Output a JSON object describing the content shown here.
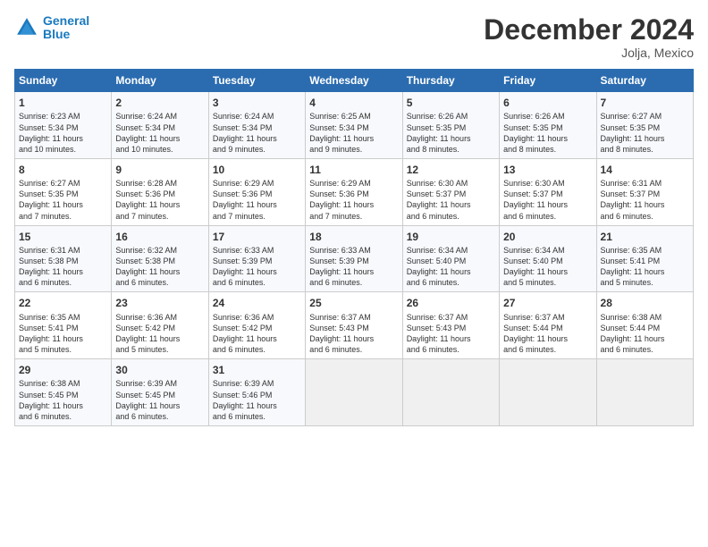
{
  "logo": {
    "line1": "General",
    "line2": "Blue"
  },
  "title": "December 2024",
  "location": "Jolja, Mexico",
  "days_header": [
    "Sunday",
    "Monday",
    "Tuesday",
    "Wednesday",
    "Thursday",
    "Friday",
    "Saturday"
  ],
  "weeks": [
    [
      {
        "day": "1",
        "info": "Sunrise: 6:23 AM\nSunset: 5:34 PM\nDaylight: 11 hours\nand 10 minutes."
      },
      {
        "day": "2",
        "info": "Sunrise: 6:24 AM\nSunset: 5:34 PM\nDaylight: 11 hours\nand 10 minutes."
      },
      {
        "day": "3",
        "info": "Sunrise: 6:24 AM\nSunset: 5:34 PM\nDaylight: 11 hours\nand 9 minutes."
      },
      {
        "day": "4",
        "info": "Sunrise: 6:25 AM\nSunset: 5:34 PM\nDaylight: 11 hours\nand 9 minutes."
      },
      {
        "day": "5",
        "info": "Sunrise: 6:26 AM\nSunset: 5:35 PM\nDaylight: 11 hours\nand 8 minutes."
      },
      {
        "day": "6",
        "info": "Sunrise: 6:26 AM\nSunset: 5:35 PM\nDaylight: 11 hours\nand 8 minutes."
      },
      {
        "day": "7",
        "info": "Sunrise: 6:27 AM\nSunset: 5:35 PM\nDaylight: 11 hours\nand 8 minutes."
      }
    ],
    [
      {
        "day": "8",
        "info": "Sunrise: 6:27 AM\nSunset: 5:35 PM\nDaylight: 11 hours\nand 7 minutes."
      },
      {
        "day": "9",
        "info": "Sunrise: 6:28 AM\nSunset: 5:36 PM\nDaylight: 11 hours\nand 7 minutes."
      },
      {
        "day": "10",
        "info": "Sunrise: 6:29 AM\nSunset: 5:36 PM\nDaylight: 11 hours\nand 7 minutes."
      },
      {
        "day": "11",
        "info": "Sunrise: 6:29 AM\nSunset: 5:36 PM\nDaylight: 11 hours\nand 7 minutes."
      },
      {
        "day": "12",
        "info": "Sunrise: 6:30 AM\nSunset: 5:37 PM\nDaylight: 11 hours\nand 6 minutes."
      },
      {
        "day": "13",
        "info": "Sunrise: 6:30 AM\nSunset: 5:37 PM\nDaylight: 11 hours\nand 6 minutes."
      },
      {
        "day": "14",
        "info": "Sunrise: 6:31 AM\nSunset: 5:37 PM\nDaylight: 11 hours\nand 6 minutes."
      }
    ],
    [
      {
        "day": "15",
        "info": "Sunrise: 6:31 AM\nSunset: 5:38 PM\nDaylight: 11 hours\nand 6 minutes."
      },
      {
        "day": "16",
        "info": "Sunrise: 6:32 AM\nSunset: 5:38 PM\nDaylight: 11 hours\nand 6 minutes."
      },
      {
        "day": "17",
        "info": "Sunrise: 6:33 AM\nSunset: 5:39 PM\nDaylight: 11 hours\nand 6 minutes."
      },
      {
        "day": "18",
        "info": "Sunrise: 6:33 AM\nSunset: 5:39 PM\nDaylight: 11 hours\nand 6 minutes."
      },
      {
        "day": "19",
        "info": "Sunrise: 6:34 AM\nSunset: 5:40 PM\nDaylight: 11 hours\nand 6 minutes."
      },
      {
        "day": "20",
        "info": "Sunrise: 6:34 AM\nSunset: 5:40 PM\nDaylight: 11 hours\nand 5 minutes."
      },
      {
        "day": "21",
        "info": "Sunrise: 6:35 AM\nSunset: 5:41 PM\nDaylight: 11 hours\nand 5 minutes."
      }
    ],
    [
      {
        "day": "22",
        "info": "Sunrise: 6:35 AM\nSunset: 5:41 PM\nDaylight: 11 hours\nand 5 minutes."
      },
      {
        "day": "23",
        "info": "Sunrise: 6:36 AM\nSunset: 5:42 PM\nDaylight: 11 hours\nand 5 minutes."
      },
      {
        "day": "24",
        "info": "Sunrise: 6:36 AM\nSunset: 5:42 PM\nDaylight: 11 hours\nand 6 minutes."
      },
      {
        "day": "25",
        "info": "Sunrise: 6:37 AM\nSunset: 5:43 PM\nDaylight: 11 hours\nand 6 minutes."
      },
      {
        "day": "26",
        "info": "Sunrise: 6:37 AM\nSunset: 5:43 PM\nDaylight: 11 hours\nand 6 minutes."
      },
      {
        "day": "27",
        "info": "Sunrise: 6:37 AM\nSunset: 5:44 PM\nDaylight: 11 hours\nand 6 minutes."
      },
      {
        "day": "28",
        "info": "Sunrise: 6:38 AM\nSunset: 5:44 PM\nDaylight: 11 hours\nand 6 minutes."
      }
    ],
    [
      {
        "day": "29",
        "info": "Sunrise: 6:38 AM\nSunset: 5:45 PM\nDaylight: 11 hours\nand 6 minutes."
      },
      {
        "day": "30",
        "info": "Sunrise: 6:39 AM\nSunset: 5:45 PM\nDaylight: 11 hours\nand 6 minutes."
      },
      {
        "day": "31",
        "info": "Sunrise: 6:39 AM\nSunset: 5:46 PM\nDaylight: 11 hours\nand 6 minutes."
      },
      {
        "day": "",
        "info": ""
      },
      {
        "day": "",
        "info": ""
      },
      {
        "day": "",
        "info": ""
      },
      {
        "day": "",
        "info": ""
      }
    ]
  ]
}
